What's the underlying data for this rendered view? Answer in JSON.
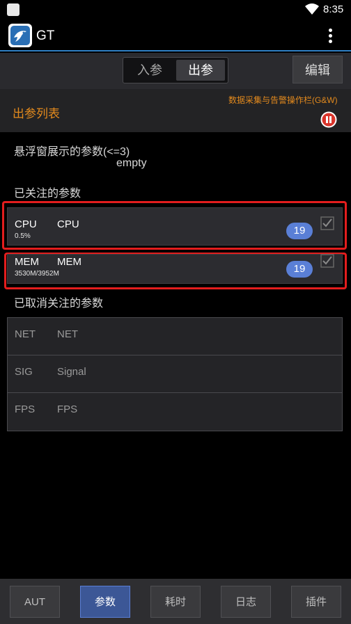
{
  "status_bar": {
    "time": "8:35"
  },
  "app": {
    "title": "GT"
  },
  "tabs": {
    "in_label": "入参",
    "out_label": "出参",
    "active": "out"
  },
  "toolbar": {
    "edit_label": "编辑"
  },
  "section": {
    "title": "出参列表",
    "note": "数据采集与告警操作栏(G&W)"
  },
  "floating": {
    "title": "悬浮窗展示的参数(<=3)",
    "empty_text": "empty"
  },
  "watched": {
    "title": "已关注的参数",
    "items": [
      {
        "alias": "CPU",
        "name": "CPU",
        "value": "0.5%",
        "count": "19",
        "checked": true
      },
      {
        "alias": "MEM",
        "name": "MEM",
        "value": "3530M/3952M",
        "count": "19",
        "checked": true
      }
    ]
  },
  "cancelled": {
    "title": "已取消关注的参数",
    "items": [
      {
        "alias": "NET",
        "name": "NET"
      },
      {
        "alias": "SIG",
        "name": "Signal"
      },
      {
        "alias": "FPS",
        "name": "FPS"
      }
    ]
  },
  "bottom_nav": {
    "items": [
      "AUT",
      "参数",
      "耗时",
      "日志",
      "插件"
    ],
    "active_index": 1
  },
  "colors": {
    "accent_orange": "#e38a1d",
    "badge_blue": "#5a7fd6",
    "highlight_red": "#e31d1d",
    "appbar_line": "#2f7fc4",
    "pause_red": "#d9342b"
  },
  "icons": [
    "square-notification-icon",
    "wifi-icon",
    "gt-app-logo",
    "overflow-menu-icon",
    "pause-icon",
    "checkbox-icon"
  ]
}
